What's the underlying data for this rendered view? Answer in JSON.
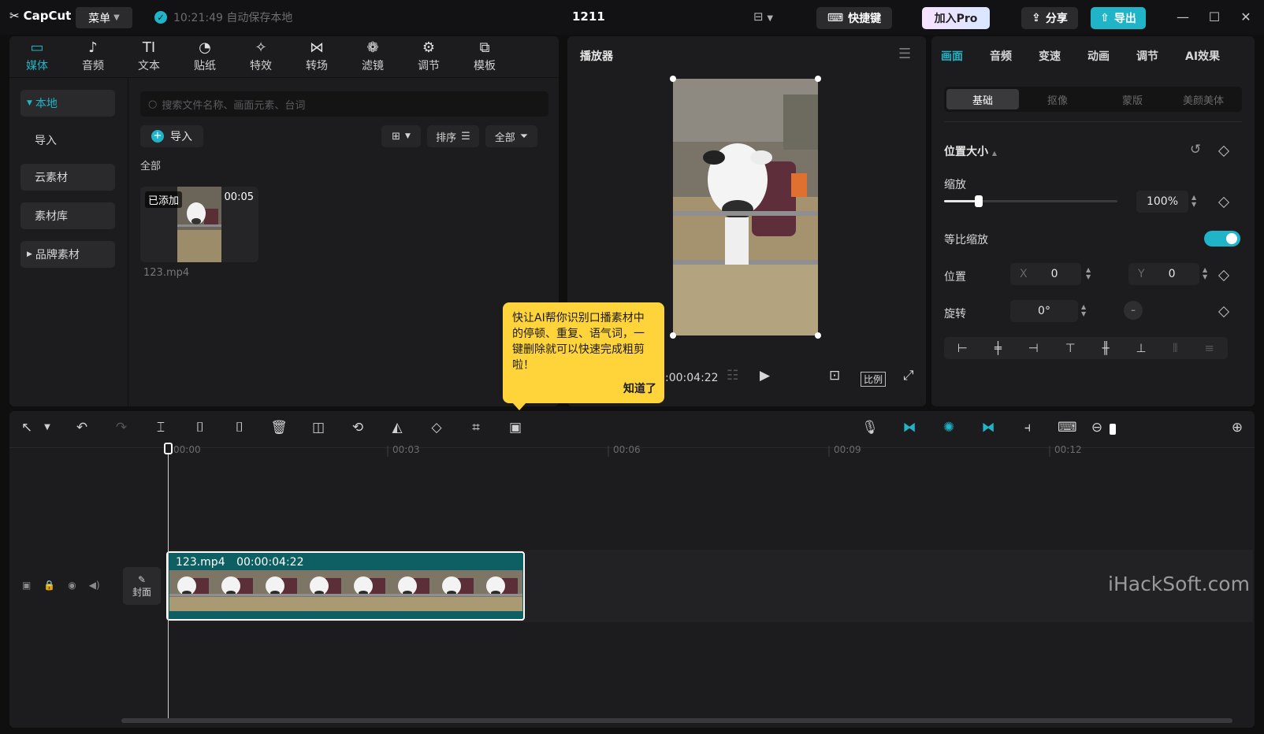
{
  "titlebar": {
    "logo": "CapCut",
    "menu_label": "菜单",
    "save_status": "10:21:49 自动保存本地",
    "project_title": "1211",
    "shortcut_label": "快捷键",
    "pro_label": "加入Pro",
    "share_label": "分享",
    "export_label": "导出"
  },
  "media_tools": [
    {
      "label": "媒体",
      "icon": "media-icon",
      "glyph": "▭"
    },
    {
      "label": "音频",
      "icon": "audio-icon",
      "glyph": "♪"
    },
    {
      "label": "文本",
      "icon": "text-icon",
      "glyph": "TI"
    },
    {
      "label": "贴纸",
      "icon": "sticker-icon",
      "glyph": "◔"
    },
    {
      "label": "特效",
      "icon": "effects-icon",
      "glyph": "✧"
    },
    {
      "label": "转场",
      "icon": "transition-icon",
      "glyph": "⋈"
    },
    {
      "label": "滤镜",
      "icon": "filter-icon",
      "glyph": "❁"
    },
    {
      "label": "调节",
      "icon": "adjust-icon",
      "glyph": "⚙"
    },
    {
      "label": "模板",
      "icon": "template-icon",
      "glyph": "⧉"
    }
  ],
  "media_sidebar": {
    "local": "本地",
    "import": "导入",
    "cloud": "云素材",
    "library": "素材库",
    "brand": "品牌素材"
  },
  "media_main": {
    "search_placeholder": "搜索文件名称、画面元素、台词",
    "import_label": "导入",
    "sort_label": "排序",
    "filter_label": "全部",
    "section_label": "全部",
    "clip": {
      "badge": "已添加",
      "duration": "00:05",
      "name": "123.mp4"
    }
  },
  "player": {
    "title": "播放器",
    "timecode": ":00:04:22",
    "ratio_label": "比例"
  },
  "tooltip": {
    "text": "快让AI帮你识别口播素材中的停顿、重复、语气词，一键删除就可以快速完成粗剪啦！",
    "ok": "知道了"
  },
  "props": {
    "tabs": [
      "画面",
      "音频",
      "变速",
      "动画",
      "调节",
      "AI效果"
    ],
    "subtabs": [
      "基础",
      "抠像",
      "蒙版",
      "美颜美体"
    ],
    "section_title": "位置大小",
    "scale_label": "缩放",
    "scale_value": "100%",
    "scale_fraction": 0.2,
    "uniform_label": "等比缩放",
    "position_label": "位置",
    "x_label": "X",
    "x_value": "0",
    "y_label": "Y",
    "y_value": "0",
    "rotate_label": "旋转",
    "rotate_value": "0°"
  },
  "timeline": {
    "ruler": [
      "00:00",
      "00:03",
      "00:06",
      "00:09",
      "00:12"
    ],
    "cover_label": "封面",
    "clip_name": "123.mp4",
    "clip_duration": "00:00:04:22",
    "watermark": "iHackSoft.com"
  },
  "colors": {
    "accent": "#1fb4c7",
    "panel": "#1c1c1e",
    "tooltip": "#ffd43b",
    "clip": "#0e5f63"
  }
}
